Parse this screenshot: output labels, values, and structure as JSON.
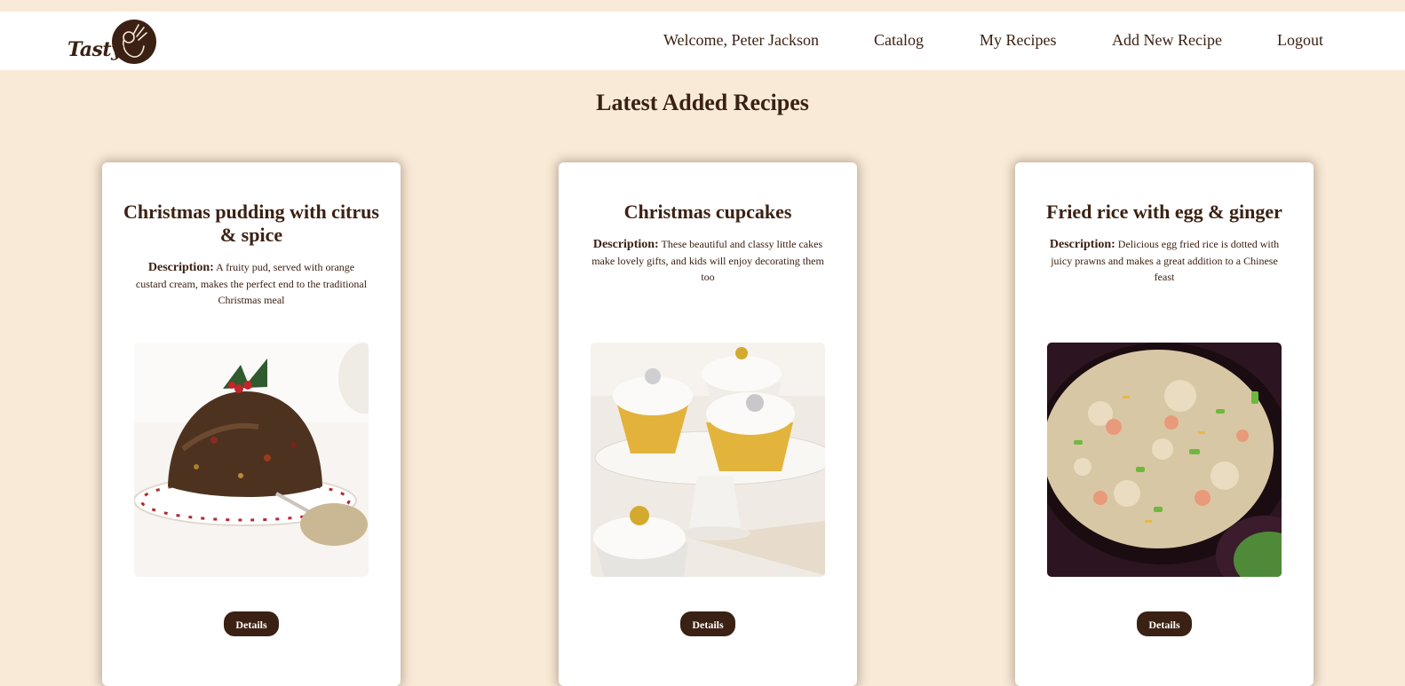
{
  "header": {
    "logo_text": "Tasty",
    "nav": {
      "welcome": "Welcome, Peter Jackson",
      "catalog": "Catalog",
      "my_recipes": "My Recipes",
      "add_new": "Add New Recipe",
      "logout": "Logout"
    }
  },
  "main": {
    "title": "Latest Added Recipes",
    "recipes": [
      {
        "title": "Christmas pudding with citrus & spice",
        "desc_label": "Description:",
        "description": "A fruity pud, served with orange custard cream, makes the perfect end to the traditional Christmas meal",
        "button": "Details"
      },
      {
        "title": "Christmas cupcakes",
        "desc_label": "Description:",
        "description": "These beautiful and classy little cakes make lovely gifts, and kids will enjoy decorating them too",
        "button": "Details"
      },
      {
        "title": "Fried rice with egg & ginger",
        "desc_label": "Description:",
        "description": "Delicious egg fried rice is dotted with juicy prawns and makes a great addition to a Chinese feast",
        "button": "Details"
      }
    ]
  },
  "colors": {
    "background": "#f9ead8",
    "accent": "#3b2113",
    "card": "#ffffff"
  }
}
